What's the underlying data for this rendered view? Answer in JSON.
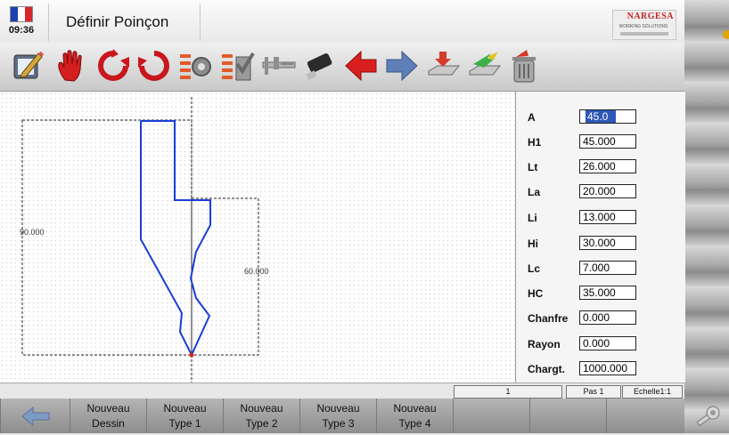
{
  "header": {
    "time": "09:36",
    "title": "Définir Poinçon",
    "logo_brand": "NARGESA",
    "logo_tagline": "WORKING SOLUTIONS",
    "flag_colors": [
      "#1f3fb0",
      "#ffffff",
      "#d7262b"
    ]
  },
  "toolbar": {
    "buttons": [
      {
        "name": "edit-drawing-icon"
      },
      {
        "name": "hand-icon"
      },
      {
        "name": "rotate-ccw-icon"
      },
      {
        "name": "rotate-cw-icon"
      },
      {
        "name": "settings-list-icon"
      },
      {
        "name": "check-list-icon"
      },
      {
        "name": "caliper-icon"
      },
      {
        "name": "usb-drive-icon"
      },
      {
        "name": "arrow-left-icon"
      },
      {
        "name": "arrow-right-icon"
      },
      {
        "name": "save-tray-icon"
      },
      {
        "name": "delete-bin-icon"
      }
    ]
  },
  "drawing": {
    "dim_height": "90.000",
    "dim_width": "60.000",
    "profile_color": "#1a3fd8"
  },
  "params": [
    {
      "label": "A",
      "value": "45.0",
      "selected": true
    },
    {
      "label": "H1",
      "value": "45.000"
    },
    {
      "label": "Lt",
      "value": "26.000"
    },
    {
      "label": "La",
      "value": "20.000"
    },
    {
      "label": "Li",
      "value": "13.000"
    },
    {
      "label": "Hi",
      "value": "30.000"
    },
    {
      "label": "Lc",
      "value": "7.000"
    },
    {
      "label": "HC",
      "value": "35.000"
    },
    {
      "label": "Chanfre",
      "value": "0.000"
    },
    {
      "label": "Rayon",
      "value": "0.000"
    },
    {
      "label": "Chargt.",
      "value": "1000.000"
    }
  ],
  "status": {
    "counter": "1",
    "step": "Pas 1",
    "scale": "Echelle1:1"
  },
  "bottom": {
    "keys": [
      {
        "line1": "Nouveau",
        "line2": "Dessin"
      },
      {
        "line1": "Nouveau",
        "line2": "Type 1"
      },
      {
        "line1": "Nouveau",
        "line2": "Type 2"
      },
      {
        "line1": "Nouveau",
        "line2": "Type 3"
      },
      {
        "line1": "Nouveau",
        "line2": "Type 4"
      }
    ]
  }
}
